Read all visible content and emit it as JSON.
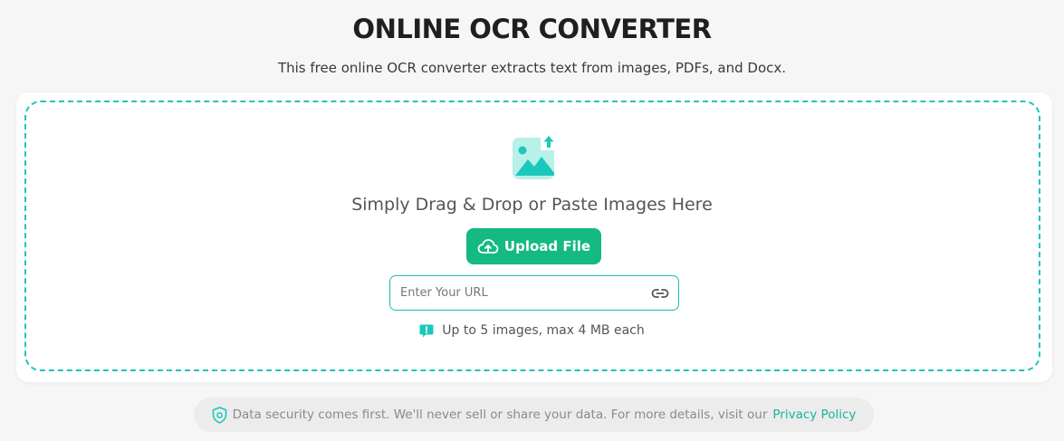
{
  "header": {
    "title": "ONLINE OCR CONVERTER",
    "subtitle": "This free online OCR converter extracts text from images, PDFs, and Docx."
  },
  "dropzone": {
    "illustration_icon": "image-upload-icon",
    "drop_text": "Simply Drag & Drop or Paste Images Here",
    "upload_button_label": "Upload File",
    "upload_button_icon": "cloud-upload-icon",
    "url_input": {
      "placeholder": "Enter Your URL",
      "value": "",
      "icon": "link-icon"
    },
    "limit_icon": "info-icon",
    "limit_text": "Up to 5 images, max 4 MB each"
  },
  "footer": {
    "shield_icon": "shield-icon",
    "security_text": "Data security comes first. We'll never sell or share your data. For more details, visit our",
    "privacy_link_label": "Privacy Policy"
  },
  "colors": {
    "accent_teal": "#20c5b8",
    "button_green": "#15b982",
    "background": "#f6f6f6",
    "link": "#17b3a3"
  }
}
